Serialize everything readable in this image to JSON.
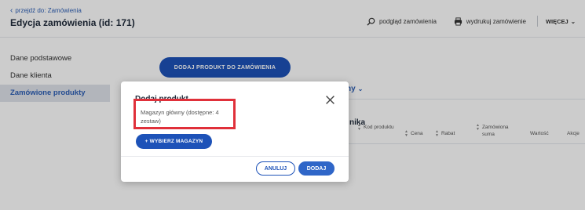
{
  "header": {
    "back_link": "przejdź do: Zamówienia",
    "title": "Edycja zamówienia (id: 171)",
    "actions": {
      "preview": "podgląd zamówienia",
      "print": "wydrukuj zamówienie",
      "more": "WIĘCEJ"
    }
  },
  "sidebar": {
    "items": [
      {
        "label": "Dane podstawowe"
      },
      {
        "label": "Dane klienta"
      },
      {
        "label": "Zamówione produkty"
      }
    ]
  },
  "main": {
    "add_product": "DODAJ PRODUKT DO ZAMÓWIENIA",
    "tab_fragment": "ny",
    "behind_fragment": "nika",
    "columns": {
      "code": "Kod produktu",
      "price": "Cena",
      "discount": "Rabat",
      "ordered_sum": "Zamówiona suma",
      "value": "Wartość",
      "actions": "Akcje"
    }
  },
  "modal": {
    "title_fragment": "Dodaj produkt",
    "warehouse_text": "Magazyn główny (dostępne: 4 zestaw)",
    "choose_warehouse": "+ WYBIERZ MAGAZYN",
    "cancel": "ANULUJ",
    "add": "DODAJ"
  },
  "colors": {
    "accent": "#1d52b8",
    "highlight": "#e0303a"
  }
}
